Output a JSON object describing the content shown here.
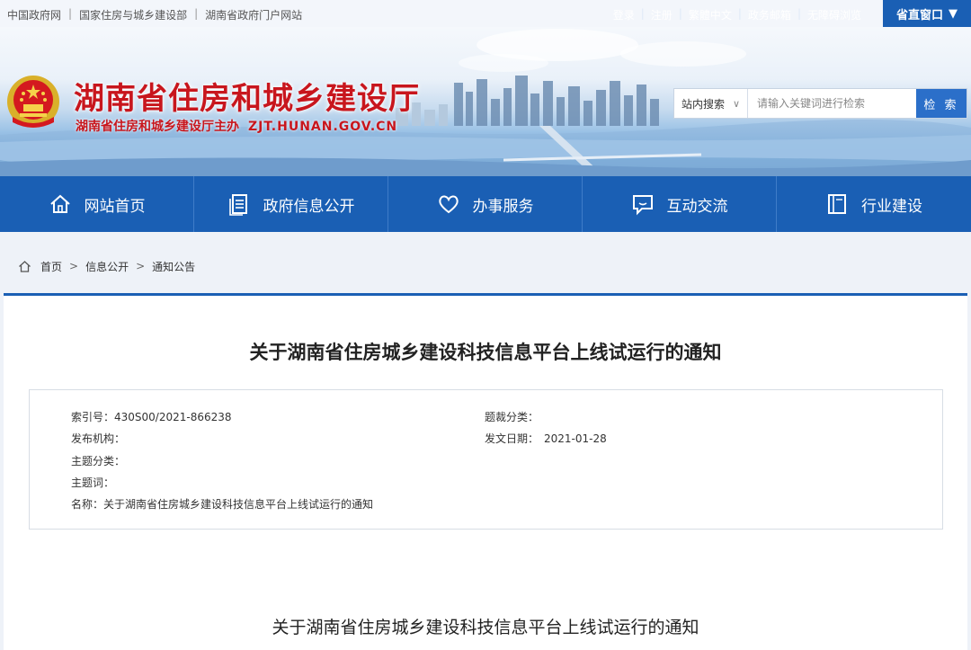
{
  "topbar": {
    "links": [
      "中国政府网",
      "国家住房与城乡建设部",
      "湖南省政府门户网站"
    ],
    "user_links": [
      "登录",
      "注册",
      "繁體中文",
      "政务邮箱",
      "无障碍浏览"
    ],
    "province_window": "省直窗口"
  },
  "header": {
    "title": "湖南省住房和城乡建设厅",
    "subtitle": "湖南省住房和城乡建设厅主办",
    "domain": "ZJT.HUNAN.GOV.CN"
  },
  "search": {
    "scope": "站内搜索",
    "placeholder": "请输入关键词进行检索",
    "button": "检 索"
  },
  "nav": [
    {
      "label": "网站首页",
      "icon": "home-icon"
    },
    {
      "label": "政府信息公开",
      "icon": "document-icon"
    },
    {
      "label": "办事服务",
      "icon": "heart-icon"
    },
    {
      "label": "互动交流",
      "icon": "chat-icon"
    },
    {
      "label": "行业建设",
      "icon": "book-icon"
    }
  ],
  "breadcrumb": [
    "首页",
    "信息公开",
    "通知公告"
  ],
  "article": {
    "title": "关于湖南省住房城乡建设科技信息平台上线试运行的通知",
    "meta": {
      "index_label": "索引号：",
      "index_value": "430S00/2021-866238",
      "topic_class_label": "题裁分类：",
      "topic_class_value": "",
      "publisher_label": "发布机构：",
      "publisher_value": "",
      "date_label": "发文日期：",
      "date_value": "2021-01-28",
      "subject_label": "主题分类：",
      "subject_value": "",
      "keyword_label": "主题词：",
      "keyword_value": "",
      "name_label": "名称：",
      "name_value": "关于湖南省住房城乡建设科技信息平台上线试运行的通知"
    },
    "heading": "关于湖南省住房城乡建设科技信息平台上线试运行的通知"
  },
  "colors": {
    "brand_blue": "#1a5fb4",
    "title_red": "#c8161d"
  }
}
